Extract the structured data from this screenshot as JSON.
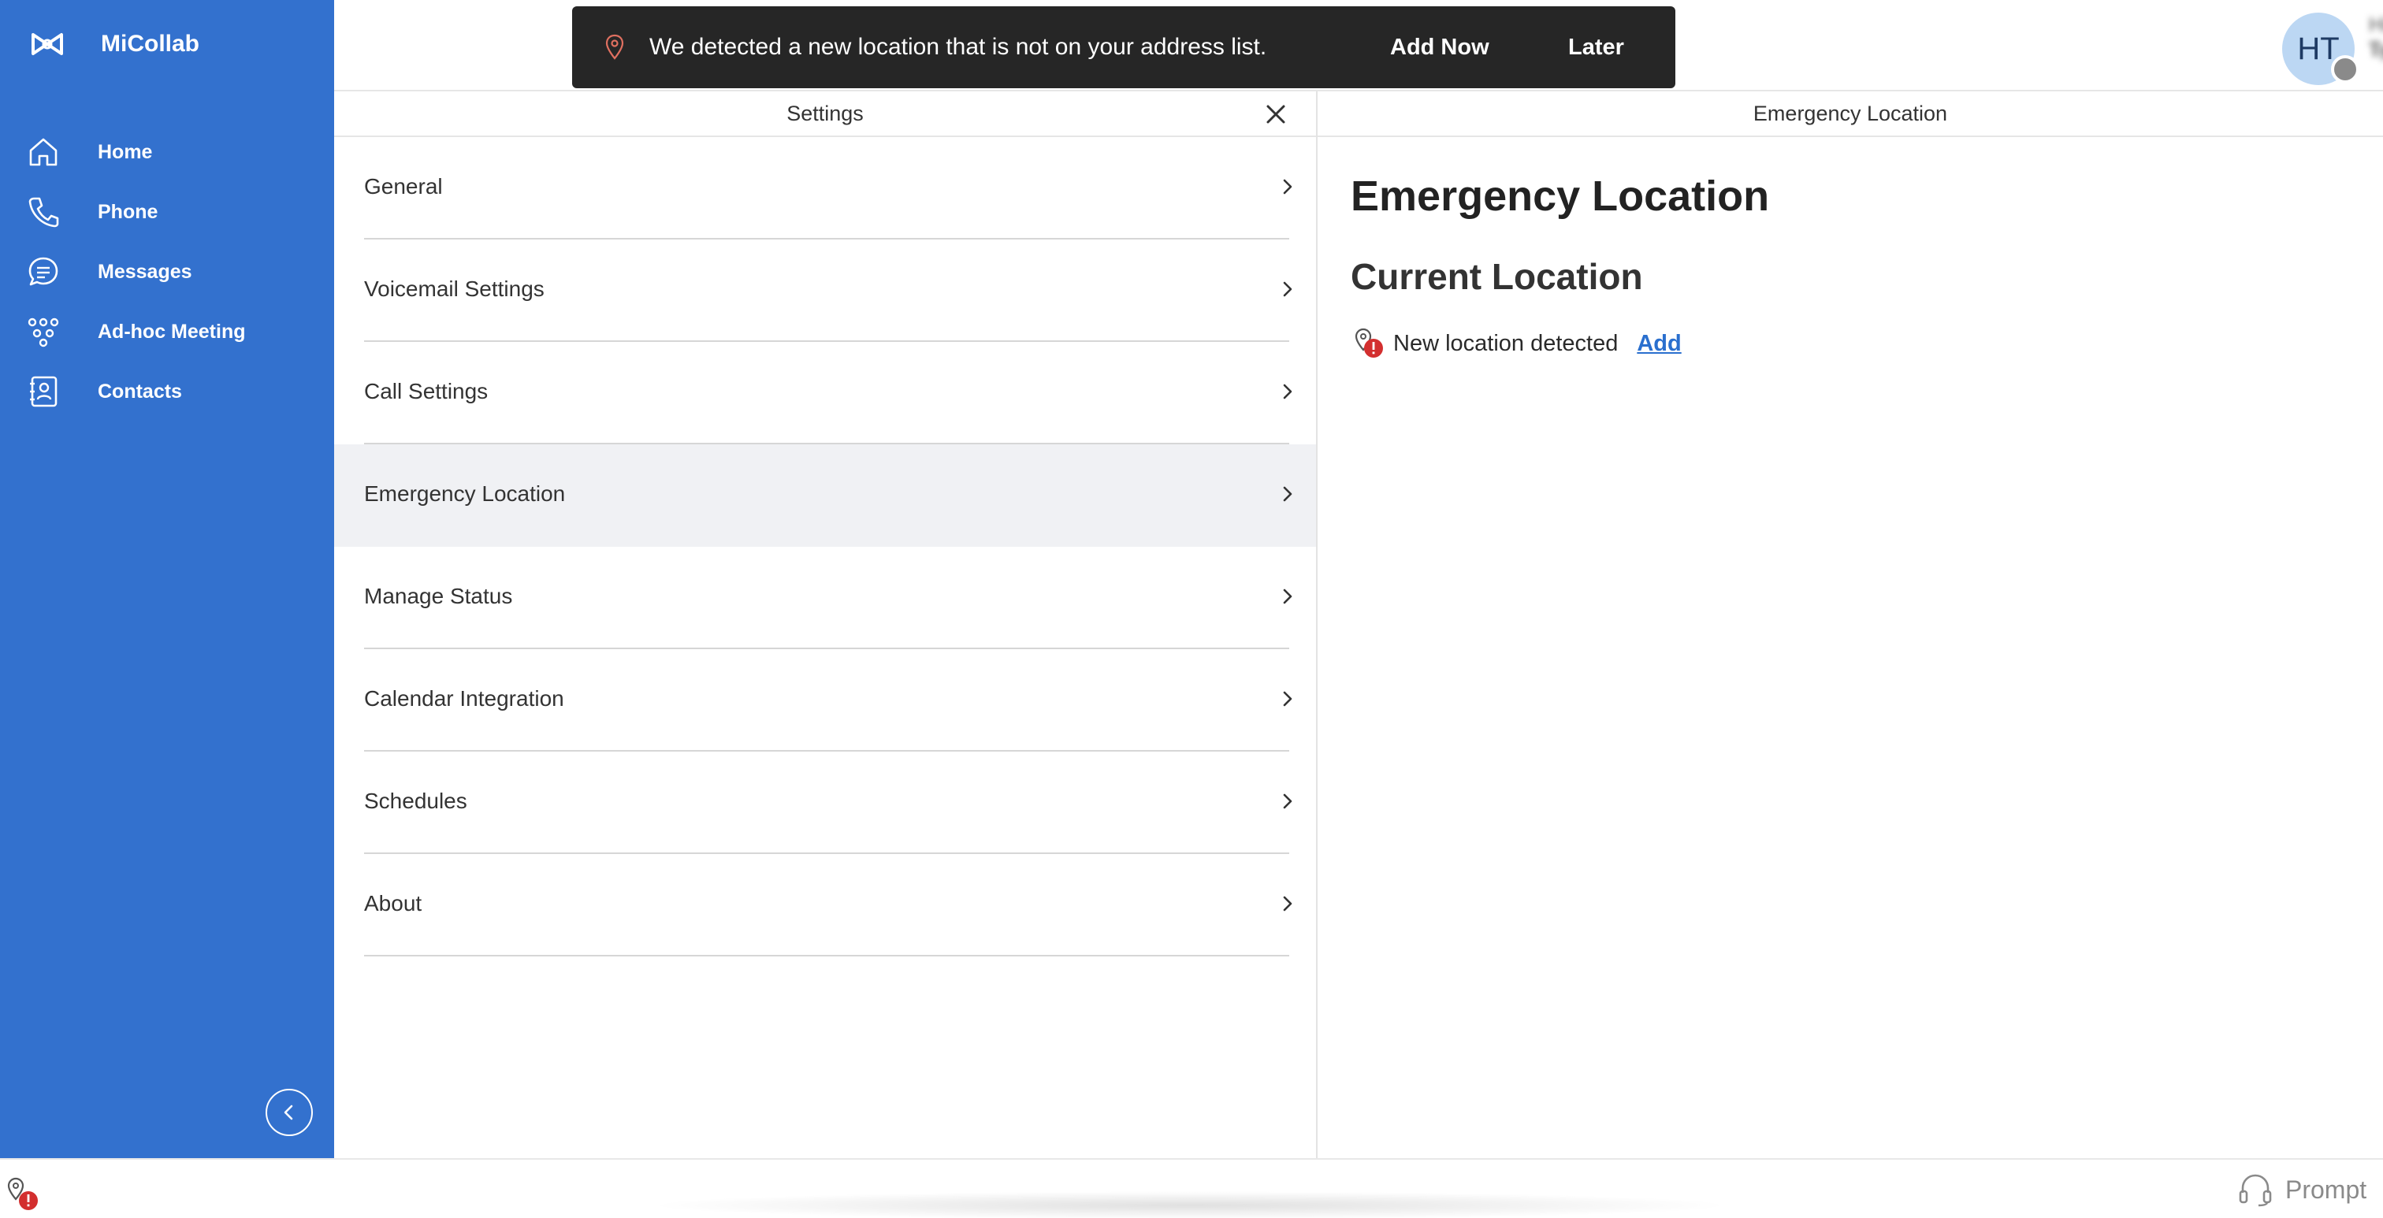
{
  "app": {
    "name": "MiCollab"
  },
  "sidebar": {
    "items": [
      {
        "label": "Home",
        "icon": "home-icon"
      },
      {
        "label": "Phone",
        "icon": "phone-icon"
      },
      {
        "label": "Messages",
        "icon": "messages-icon"
      },
      {
        "label": "Ad-hoc Meeting",
        "icon": "meeting-icon"
      },
      {
        "label": "Contacts",
        "icon": "contacts-icon"
      }
    ],
    "collapse_icon": "chevron-left-icon",
    "background_color": "#3371ce"
  },
  "toast": {
    "message": "We detected a new location that is not on your address list.",
    "add_label": "Add Now",
    "later_label": "Later"
  },
  "user": {
    "initials": "HT",
    "name": "Himani Tyagi",
    "status": "Test_Status"
  },
  "settings": {
    "title": "Settings",
    "items": [
      {
        "label": "General"
      },
      {
        "label": "Voicemail Settings"
      },
      {
        "label": "Call Settings"
      },
      {
        "label": "Emergency Location",
        "selected": true
      },
      {
        "label": "Manage Status"
      },
      {
        "label": "Calendar Integration"
      },
      {
        "label": "Schedules"
      },
      {
        "label": "About"
      }
    ]
  },
  "detail": {
    "header": "Emergency Location",
    "title": "Emergency Location",
    "subtitle": "Current Location",
    "location_text": "New location detected",
    "add_label": "Add"
  },
  "statusbar": {
    "prompt_label": "Prompt"
  },
  "colors": {
    "accent_link": "#2a6fce",
    "alert_red": "#d32f2f",
    "toast_bg": "#262626"
  }
}
